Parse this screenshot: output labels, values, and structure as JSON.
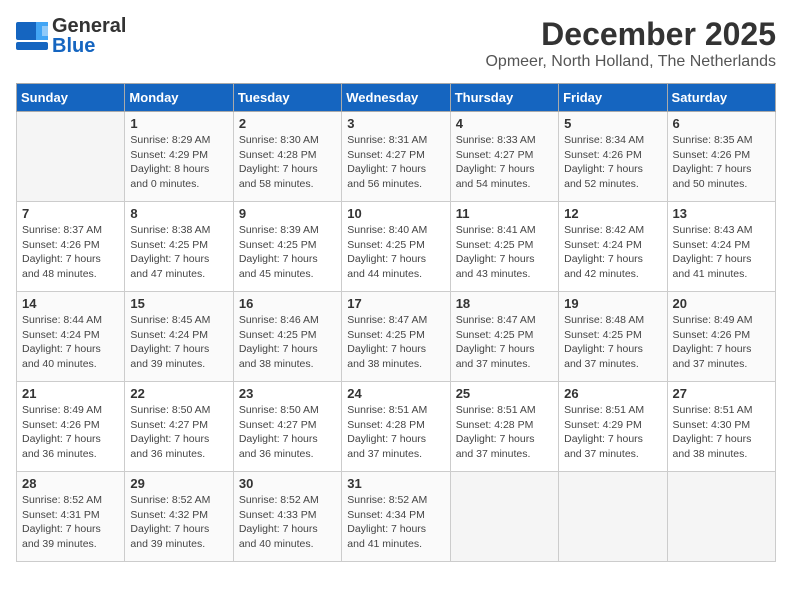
{
  "logo": {
    "line1": "General",
    "line2": "Blue"
  },
  "calendar": {
    "title": "December 2025",
    "subtitle": "Opmeer, North Holland, The Netherlands",
    "headers": [
      "Sunday",
      "Monday",
      "Tuesday",
      "Wednesday",
      "Thursday",
      "Friday",
      "Saturday"
    ],
    "weeks": [
      [
        {
          "day": "",
          "info": ""
        },
        {
          "day": "1",
          "info": "Sunrise: 8:29 AM\nSunset: 4:29 PM\nDaylight: 8 hours\nand 0 minutes."
        },
        {
          "day": "2",
          "info": "Sunrise: 8:30 AM\nSunset: 4:28 PM\nDaylight: 7 hours\nand 58 minutes."
        },
        {
          "day": "3",
          "info": "Sunrise: 8:31 AM\nSunset: 4:27 PM\nDaylight: 7 hours\nand 56 minutes."
        },
        {
          "day": "4",
          "info": "Sunrise: 8:33 AM\nSunset: 4:27 PM\nDaylight: 7 hours\nand 54 minutes."
        },
        {
          "day": "5",
          "info": "Sunrise: 8:34 AM\nSunset: 4:26 PM\nDaylight: 7 hours\nand 52 minutes."
        },
        {
          "day": "6",
          "info": "Sunrise: 8:35 AM\nSunset: 4:26 PM\nDaylight: 7 hours\nand 50 minutes."
        }
      ],
      [
        {
          "day": "7",
          "info": "Sunrise: 8:37 AM\nSunset: 4:26 PM\nDaylight: 7 hours\nand 48 minutes."
        },
        {
          "day": "8",
          "info": "Sunrise: 8:38 AM\nSunset: 4:25 PM\nDaylight: 7 hours\nand 47 minutes."
        },
        {
          "day": "9",
          "info": "Sunrise: 8:39 AM\nSunset: 4:25 PM\nDaylight: 7 hours\nand 45 minutes."
        },
        {
          "day": "10",
          "info": "Sunrise: 8:40 AM\nSunset: 4:25 PM\nDaylight: 7 hours\nand 44 minutes."
        },
        {
          "day": "11",
          "info": "Sunrise: 8:41 AM\nSunset: 4:25 PM\nDaylight: 7 hours\nand 43 minutes."
        },
        {
          "day": "12",
          "info": "Sunrise: 8:42 AM\nSunset: 4:24 PM\nDaylight: 7 hours\nand 42 minutes."
        },
        {
          "day": "13",
          "info": "Sunrise: 8:43 AM\nSunset: 4:24 PM\nDaylight: 7 hours\nand 41 minutes."
        }
      ],
      [
        {
          "day": "14",
          "info": "Sunrise: 8:44 AM\nSunset: 4:24 PM\nDaylight: 7 hours\nand 40 minutes."
        },
        {
          "day": "15",
          "info": "Sunrise: 8:45 AM\nSunset: 4:24 PM\nDaylight: 7 hours\nand 39 minutes."
        },
        {
          "day": "16",
          "info": "Sunrise: 8:46 AM\nSunset: 4:25 PM\nDaylight: 7 hours\nand 38 minutes."
        },
        {
          "day": "17",
          "info": "Sunrise: 8:47 AM\nSunset: 4:25 PM\nDaylight: 7 hours\nand 38 minutes."
        },
        {
          "day": "18",
          "info": "Sunrise: 8:47 AM\nSunset: 4:25 PM\nDaylight: 7 hours\nand 37 minutes."
        },
        {
          "day": "19",
          "info": "Sunrise: 8:48 AM\nSunset: 4:25 PM\nDaylight: 7 hours\nand 37 minutes."
        },
        {
          "day": "20",
          "info": "Sunrise: 8:49 AM\nSunset: 4:26 PM\nDaylight: 7 hours\nand 37 minutes."
        }
      ],
      [
        {
          "day": "21",
          "info": "Sunrise: 8:49 AM\nSunset: 4:26 PM\nDaylight: 7 hours\nand 36 minutes."
        },
        {
          "day": "22",
          "info": "Sunrise: 8:50 AM\nSunset: 4:27 PM\nDaylight: 7 hours\nand 36 minutes."
        },
        {
          "day": "23",
          "info": "Sunrise: 8:50 AM\nSunset: 4:27 PM\nDaylight: 7 hours\nand 36 minutes."
        },
        {
          "day": "24",
          "info": "Sunrise: 8:51 AM\nSunset: 4:28 PM\nDaylight: 7 hours\nand 37 minutes."
        },
        {
          "day": "25",
          "info": "Sunrise: 8:51 AM\nSunset: 4:28 PM\nDaylight: 7 hours\nand 37 minutes."
        },
        {
          "day": "26",
          "info": "Sunrise: 8:51 AM\nSunset: 4:29 PM\nDaylight: 7 hours\nand 37 minutes."
        },
        {
          "day": "27",
          "info": "Sunrise: 8:51 AM\nSunset: 4:30 PM\nDaylight: 7 hours\nand 38 minutes."
        }
      ],
      [
        {
          "day": "28",
          "info": "Sunrise: 8:52 AM\nSunset: 4:31 PM\nDaylight: 7 hours\nand 39 minutes."
        },
        {
          "day": "29",
          "info": "Sunrise: 8:52 AM\nSunset: 4:32 PM\nDaylight: 7 hours\nand 39 minutes."
        },
        {
          "day": "30",
          "info": "Sunrise: 8:52 AM\nSunset: 4:33 PM\nDaylight: 7 hours\nand 40 minutes."
        },
        {
          "day": "31",
          "info": "Sunrise: 8:52 AM\nSunset: 4:34 PM\nDaylight: 7 hours\nand 41 minutes."
        },
        {
          "day": "",
          "info": ""
        },
        {
          "day": "",
          "info": ""
        },
        {
          "day": "",
          "info": ""
        }
      ]
    ]
  }
}
